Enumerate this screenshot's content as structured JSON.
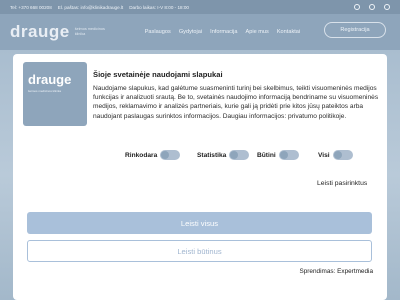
{
  "background": {
    "topbar": {
      "phone": "Tel: +370 668 00208",
      "email": "El. paštas: info@klinikadrauge.lt",
      "hours": "Darbo laikas: I-V 8:00 - 18:00"
    },
    "brand": {
      "name": "drauge",
      "subtitle": "šeimos medicinos klinika"
    },
    "nav": [
      "Paslaugos",
      "Gydytojai",
      "Informacija",
      "Apie mus",
      "Kontaktai"
    ],
    "register_label": "Registracija"
  },
  "modal": {
    "logo": {
      "name": "drauge",
      "subtitle": "šeimos medicinos klinika"
    },
    "title": "Šioje svetainėje naudojami slapukai",
    "body": "Naudojame slapukus, kad galėtume suasmeninti turinį bei skelbimus, teikti visuomeninės medijos funkcijas ir analizuoti srautą. Be to, svetainės naudojimo informaciją bendriname su visuomeninės medijos, reklamavimo ir analizės partneriais, kurie gali ją pridėti prie kitos jūsų pateiktos arba naudojant paslaugas surinktos informacijos. Daugiau informacijos: privatumo politikoje.",
    "toggles": [
      {
        "label": "Rinkodara"
      },
      {
        "label": "Statistika"
      },
      {
        "label": "Būtini"
      },
      {
        "label": "Visi"
      }
    ],
    "preferences_link": "Leisti pasirinktus",
    "accept_all": "Leisti visus",
    "accept_required": "Leisti būtinus",
    "powered_by": "Sprendimas: Expertmedia"
  },
  "colors": {
    "accent": "#a9c0da",
    "toggle_track": "#aebed0",
    "toggle_knob": "#8ea5bb"
  }
}
